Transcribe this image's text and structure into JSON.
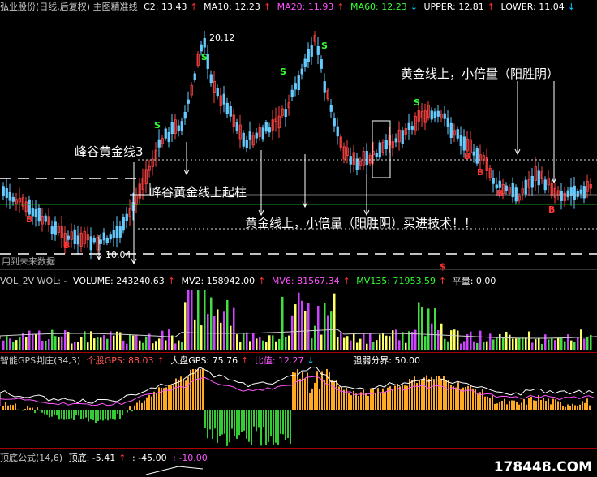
{
  "main_header": {
    "title": "弘业股份(日线,后复权) 主图精准线",
    "c2": "C2: 13.43",
    "ma10": "MA10: 12.23",
    "ma20": "MA20: 11.93",
    "ma60": "MA60: 12.23",
    "upper": "UPPER: 12.81",
    "lower": "LOWER: 11.04",
    "colors": {
      "title": "#c8c8c8",
      "c2": "#ffffff",
      "ma10": "#ffffff",
      "ma20": "#ff55ff",
      "ma60": "#33ff33",
      "upper": "#ffffff",
      "lower": "#ffffff",
      "arrow": "#ff3333"
    }
  },
  "main_chart": {
    "high_label": "20.12",
    "low_label": "10.04",
    "future_label": "用到未来数据",
    "signals_s": [
      "S",
      "S",
      "S",
      "S",
      "S"
    ],
    "signals_b": [
      "B",
      "B",
      "B",
      "B",
      "B",
      "B"
    ],
    "dollar": "$"
  },
  "annotations": {
    "a1": "峰谷黄金线3",
    "a2": "峰谷黄金线上起柱",
    "a3": "黄金线上，小倍量（阳胜阴）买进技术！！",
    "a4": "黄金线上，小倍量（阳胜阴）"
  },
  "vol_header": {
    "name": "VOL_2V WOL: -",
    "volume": "VOLUME: 243240.63",
    "mv2": "MV2: 158942.00",
    "mv6": "MV6: 81567.34",
    "mv135": "MV135: 71953.59",
    "pl": "平量: 0.00",
    "colors": {
      "name": "#c8c8c8",
      "volume": "#ffffff",
      "mv2": "#ffffff",
      "mv6": "#ff55ff",
      "mv135": "#33ff33",
      "pl": "#ffffff"
    }
  },
  "gps_header": {
    "name": "智能GPS判庄(34,3)",
    "stock": "个股GPS: 88.03",
    "market": "大盘GPS: 75.76",
    "ratio": "比值: 12.27",
    "strong": "强弱分界: 50.00",
    "colors": {
      "name": "#c8c8c8",
      "stock": "#ff5555",
      "market": "#ffffff",
      "ratio": "#ff55ff",
      "strong": "#ffffff"
    }
  },
  "bottom_header": {
    "name": "顶底公式(14,6)",
    "top": "顶底: -5.41",
    "v1": ": -45.00",
    "v2": ": -10.00",
    "colors": {
      "name": "#c8c8c8",
      "top": "#ffffff",
      "v1": "#ffffff",
      "v2": "#ff55ff"
    }
  },
  "watermark": "178448.COM"
}
